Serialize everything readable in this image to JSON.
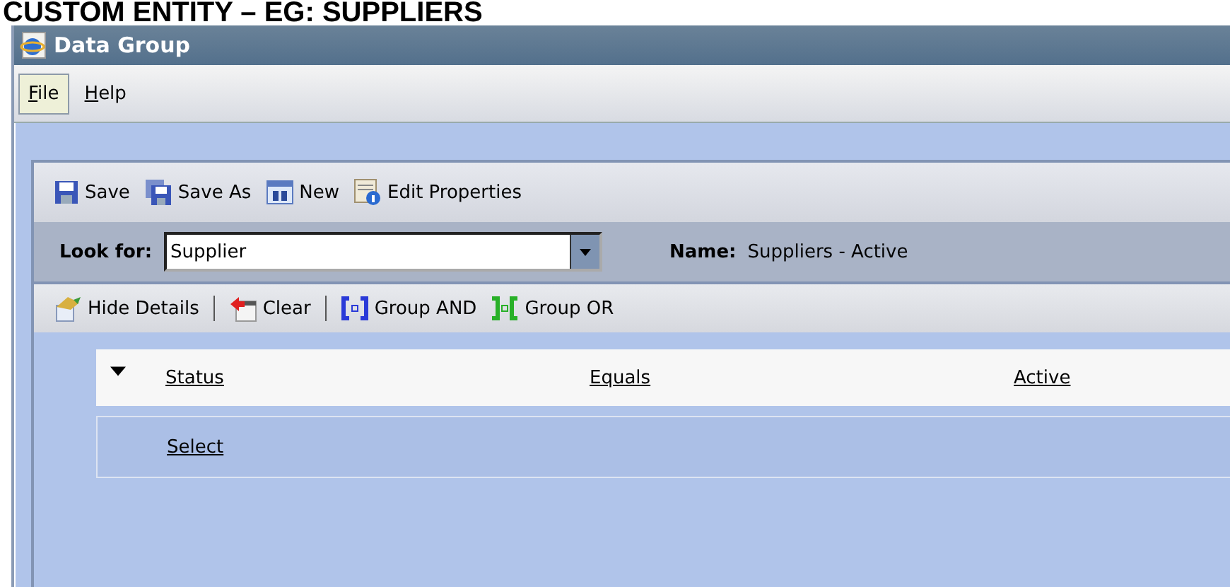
{
  "heading": "CUSTOM ENTITY – EG: SUPPLIERS",
  "window": {
    "title": "Data Group"
  },
  "menu": [
    {
      "label": "File",
      "selected": true
    },
    {
      "label": "Help",
      "selected": false
    }
  ],
  "toolbar": [
    {
      "label": "Save",
      "kind": "save"
    },
    {
      "label": "Save As",
      "kind": "saveas"
    },
    {
      "label": "New",
      "kind": "new"
    },
    {
      "label": "Edit Properties",
      "kind": "props"
    }
  ],
  "look_for": {
    "label": "Look for:",
    "value": "Supplier"
  },
  "name": {
    "label": "Name:",
    "value": "Suppliers - Active"
  },
  "filter_toolbar": [
    {
      "label": "Hide Details",
      "kind": "details"
    },
    {
      "label": "Clear",
      "kind": "clear"
    },
    {
      "label": "Group AND",
      "kind": "and"
    },
    {
      "label": "Group OR",
      "kind": "or"
    }
  ],
  "conditions": [
    {
      "field": "Status",
      "operator": "Equals",
      "value": "Active"
    }
  ],
  "select_row": {
    "label": "Select"
  }
}
